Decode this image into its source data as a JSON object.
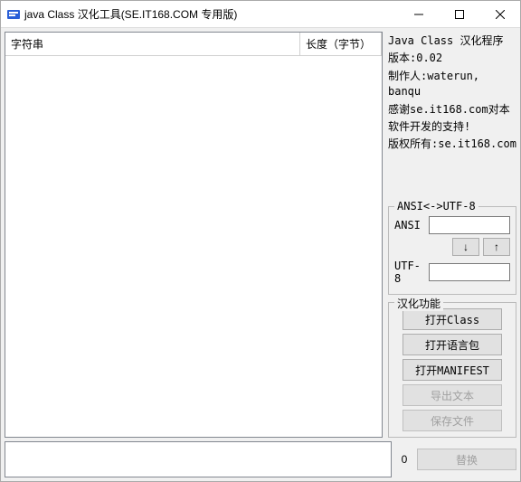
{
  "window": {
    "title": "java Class 汉化工具(SE.IT168.COM 专用版)"
  },
  "table": {
    "col_string": "字符串",
    "col_length": "长度（字节）"
  },
  "info": {
    "heading": "Java Class 汉化程序",
    "version_label": "版本:0.02",
    "author": "制作人:waterun, banqu",
    "thanks1": "感谢se.it168.com对本",
    "thanks2": "软件开发的支持!",
    "copyright": "版权所有:se.it168.com"
  },
  "conv": {
    "legend": "ANSI<->UTF-8",
    "ansi_label": "ANSI",
    "utf8_label": "UTF-8",
    "down": "↓",
    "up": "↑",
    "ansi_value": "",
    "utf8_value": ""
  },
  "funcs": {
    "legend": "汉化功能",
    "open_class": "打开Class",
    "open_lang": "打开语言包",
    "open_manifest": "打开MANIFEST",
    "export_text": "导出文本",
    "save_file": "保存文件"
  },
  "bottom": {
    "count": "0",
    "replace": "替换"
  }
}
